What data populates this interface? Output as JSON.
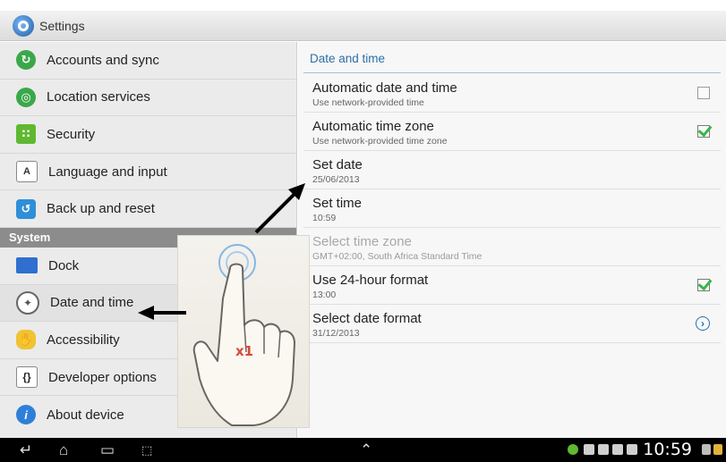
{
  "app": {
    "title": "Settings"
  },
  "sidebar": {
    "items_top": [
      {
        "label": "Accounts and sync",
        "icon": "sync-icon"
      },
      {
        "label": "Location services",
        "icon": "location-icon"
      },
      {
        "label": "Security",
        "icon": "security-icon"
      },
      {
        "label": "Language and input",
        "icon": "keyboard-icon"
      },
      {
        "label": "Back up and reset",
        "icon": "backup-icon"
      }
    ],
    "section_header": "System",
    "items_system": [
      {
        "label": "Dock",
        "icon": "dock-icon"
      },
      {
        "label": "Date and time",
        "icon": "clock-icon",
        "selected": true
      },
      {
        "label": "Accessibility",
        "icon": "hand-icon"
      },
      {
        "label": "Developer options",
        "icon": "braces-icon"
      },
      {
        "label": "About device",
        "icon": "info-icon"
      }
    ]
  },
  "main": {
    "section_title": "Date and time",
    "rows": [
      {
        "title": "Automatic date and time",
        "subtitle": "Use network-provided time",
        "control": "checkbox",
        "checked": false
      },
      {
        "title": "Automatic time zone",
        "subtitle": "Use network-provided time zone",
        "control": "checkbox",
        "checked": true
      },
      {
        "title": "Set date",
        "subtitle": "25/06/2013"
      },
      {
        "title": "Set time",
        "subtitle": "10:59"
      },
      {
        "title": "Select time zone",
        "subtitle": "GMT+02:00, South Africa Standard Time",
        "disabled": true
      },
      {
        "title": "Use 24-hour format",
        "subtitle": "13:00",
        "control": "checkbox",
        "checked": true
      },
      {
        "title": "Select date format",
        "subtitle": "31/12/2013",
        "control": "chevron"
      }
    ]
  },
  "overlay": {
    "tap_count": "x1"
  },
  "navbar": {
    "clock": "10:59"
  },
  "colors": {
    "accent": "#2a6fa8",
    "check": "#39b54a",
    "sidebar_bg": "#ebebeb",
    "header_bg": "#8c8c8c"
  }
}
